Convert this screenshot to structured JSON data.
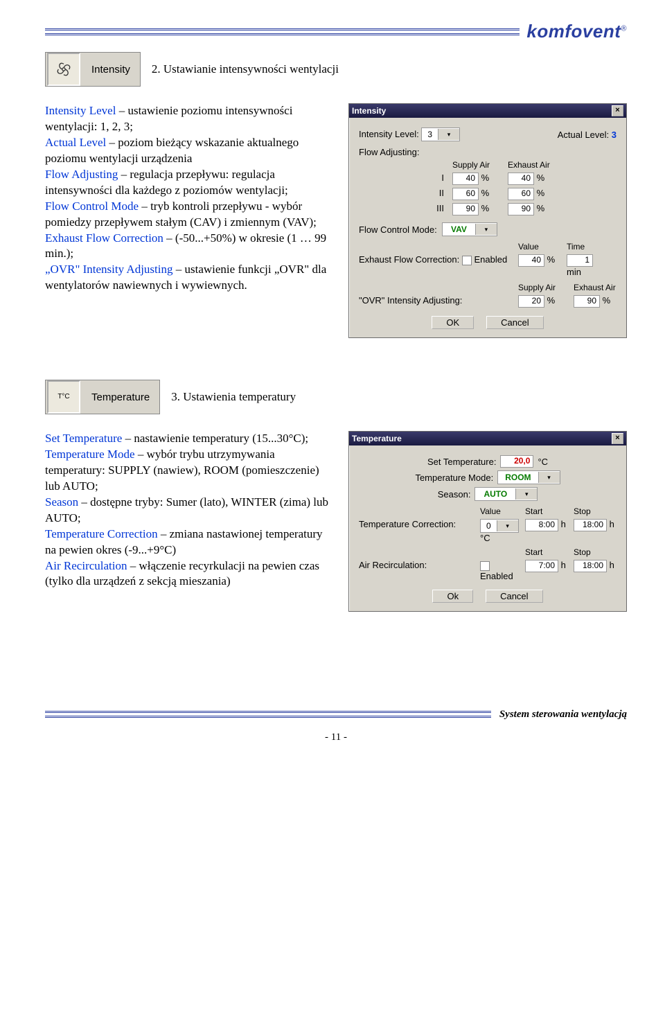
{
  "brand": "komfovent",
  "section1": {
    "btn_label": "Intensity",
    "heading": "2. Ustawianie intensywności wentylacji",
    "body": [
      {
        "t": "Intensity Level",
        "b": true,
        "s": " – ustawienie poziomu intensywności wentylacji: 1, 2, 3;"
      },
      {
        "t": "Actual Level",
        "b": true,
        "s": " – poziom bieżący wskazanie aktualnego poziomu wentylacji urządzenia"
      },
      {
        "t": "Flow Adjusting",
        "b": true,
        "s": " – regulacja przepływu: regulacja intensywności dla każdego z poziomów wentylacji;"
      },
      {
        "t": "Flow Control Mode",
        "b": true,
        "s": " – tryb kontroli przepływu - wybór pomiedzy przepływem stałym (CAV) i zmiennym (VAV);"
      },
      {
        "t": "Exhaust Flow Correction",
        "b": true,
        "s": " – (-50...+50%) w okresie (1 … 99 min.);"
      },
      {
        "t": "„OVR\" Intensity Adjusting",
        "b": true,
        "s": " – ustawienie funkcji „OVR\" dla wentylatorów nawiewnych i wywiewnych."
      }
    ]
  },
  "dlg1": {
    "title": "Intensity",
    "labels": {
      "il": "Intensity Level:",
      "al": "Actual Level:",
      "fa": "Flow Adjusting:",
      "sa": "Supply Air",
      "ea": "Exhaust Air",
      "r1": "I",
      "r2": "II",
      "r3": "III",
      "fcm": "Flow Control Mode:",
      "efc": "Exhaust Flow Correction:",
      "en": "Enabled",
      "val": "Value",
      "time": "Time",
      "ovr": "\"OVR\" Intensity Adjusting:",
      "ok": "OK",
      "cancel": "Cancel"
    },
    "vals": {
      "il": "3",
      "al": "3",
      "g": [
        [
          "40",
          "40"
        ],
        [
          "60",
          "60"
        ],
        [
          "90",
          "90"
        ]
      ],
      "fcm": "VAV",
      "efcv": "40",
      "efct": "1",
      "ovr_s": "20",
      "ovr_e": "90"
    }
  },
  "section2": {
    "btn_label": "Temperature",
    "btn_icon": "T°C",
    "heading": "3. Ustawienia temperatury",
    "body": [
      {
        "t": "Set Temperature",
        "b": true,
        "s": " – nastawienie temperatury (15...30°C);"
      },
      {
        "t": "Temperature Mode",
        "b": true,
        "s": " – wybór trybu utrzymywania temperatury: SUPPLY (nawiew), ROOM (pomieszczenie) lub AUTO;"
      },
      {
        "t": "Season",
        "b": true,
        "s": " – dostępne tryby: Sumer (lato), WINTER (zima) lub AUTO;"
      },
      {
        "t": "Temperature Correction",
        "b": true,
        "s": " – zmiana nastawionej temperatury na pewien okres (-9...+9°C)"
      },
      {
        "t": "Air Recirculation",
        "b": true,
        "s": " – włączenie recyrkulacji na pewien czas (tylko dla urządzeń z sekcją mieszania)"
      }
    ]
  },
  "dlg2": {
    "title": "Temperature",
    "labels": {
      "st": "Set Temperature:",
      "tm": "Temperature Mode:",
      "se": "Season:",
      "tc": "Temperature Correction:",
      "ar": "Air Recirculation:",
      "en": "Enabled",
      "val": "Value",
      "start": "Start",
      "stop": "Stop",
      "ok": "Ok",
      "cancel": "Cancel"
    },
    "vals": {
      "st": "20,0",
      "tm": "ROOM",
      "se": "AUTO",
      "tcv": "0",
      "tcs": "8:00",
      "tce": "18:00",
      "ars": "7:00",
      "are": "18:00"
    }
  },
  "footer_label": "System sterowania wentylacją",
  "page_num": "- 11 -"
}
